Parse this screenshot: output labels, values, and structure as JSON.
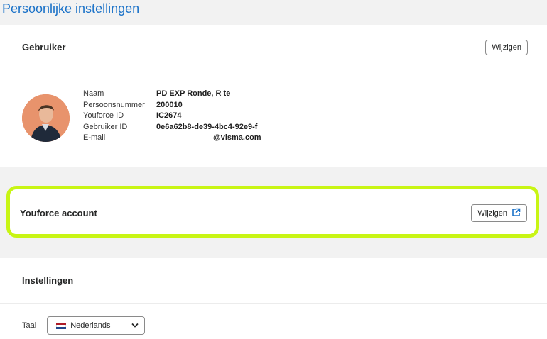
{
  "page": {
    "title": "Persoonlijke instellingen"
  },
  "user_card": {
    "title": "Gebruiker",
    "edit_label": "Wijzigen",
    "fields": [
      {
        "label": "Naam",
        "value": "PD EXP Ronde, R te"
      },
      {
        "label": "Persoonsnummer",
        "value": "200010"
      },
      {
        "label": "Youforce ID",
        "value": "IC2674"
      },
      {
        "label": "Gebruiker ID",
        "value": "0e6a62b8-de39-4bc4-92e9-f"
      },
      {
        "label": "E-mail",
        "value": "@visma.com"
      }
    ]
  },
  "youforce_card": {
    "title": "Youforce account",
    "edit_label": "Wijzigen",
    "edit_icon": "external-link-icon",
    "highlight_color": "#c8f514"
  },
  "settings_card": {
    "title": "Instellingen",
    "language_label": "Taal",
    "language_value": "Nederlands",
    "language_icon": "netherlands-flag-icon"
  },
  "colors": {
    "accent": "#1b72c8",
    "background": "#f2f2f2"
  }
}
